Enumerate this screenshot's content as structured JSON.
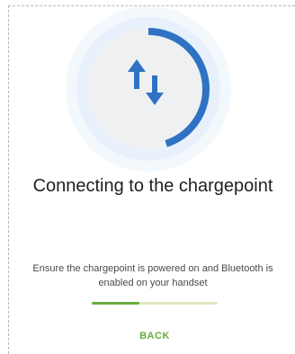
{
  "connection": {
    "title": "Connecting to the chargepoint",
    "message": "Ensure the chargepoint is powered on and Bluetooth is enabled on your handset",
    "icon": "transfer-arrows-icon",
    "ring_progress": 0.45,
    "loader_progress": 0.38
  },
  "actions": {
    "back_label": "BACK"
  },
  "colors": {
    "accent_blue": "#2f72c4",
    "ring_track": "#eef0f2",
    "halo": "#e8f1fb",
    "accent_green": "#6aab3c",
    "loader_track": "#dfe8c2",
    "title_text": "#1f1f1f",
    "body_text": "#4a4a4a"
  }
}
